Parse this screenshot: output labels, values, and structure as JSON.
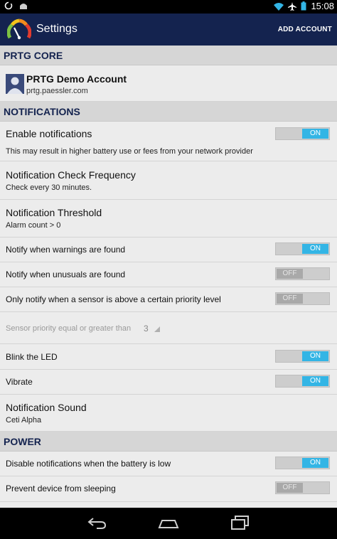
{
  "status_bar": {
    "time": "15:08",
    "icons": [
      "circle-notification-icon",
      "android-icon",
      "wifi-icon",
      "airplane-mode-icon",
      "battery-icon"
    ]
  },
  "action_bar": {
    "title": "Settings",
    "add_account": "ADD ACCOUNT",
    "logo": "prtg-gauge-logo"
  },
  "sections": {
    "core": {
      "header": "PRTG CORE"
    },
    "notifications": {
      "header": "NOTIFICATIONS"
    },
    "power": {
      "header": "POWER"
    }
  },
  "account": {
    "name": "PRTG Demo Account",
    "host": "prtg.paessler.com",
    "icon": "person-icon"
  },
  "notifications": {
    "enable": {
      "title": "Enable notifications",
      "summary": "This may result in higher battery use or fees from your network provider",
      "toggle": "ON"
    },
    "check_frequency": {
      "title": "Notification Check Frequency",
      "summary": "Check every 30 minutes."
    },
    "threshold": {
      "title": "Notification Threshold",
      "summary": "Alarm count > 0"
    },
    "warnings": {
      "title": "Notify when warnings are found",
      "toggle": "ON"
    },
    "unusuals": {
      "title": "Notify when unusuals are found",
      "toggle": "OFF"
    },
    "priority_only": {
      "title": "Only notify when a sensor is above a certain priority level",
      "toggle": "OFF"
    },
    "priority_level": {
      "title": "Sensor priority equal or greater than",
      "value": "3"
    },
    "blink_led": {
      "title": "Blink the LED",
      "toggle": "ON"
    },
    "vibrate": {
      "title": "Vibrate",
      "toggle": "ON"
    },
    "sound": {
      "title": "Notification Sound",
      "summary": "Ceti Alpha"
    }
  },
  "power": {
    "battery_low": {
      "title": "Disable notifications when the battery is low",
      "toggle": "ON"
    },
    "prevent_sleep": {
      "title": "Prevent device from sleeping",
      "toggle": "OFF"
    }
  },
  "nav_bar": {
    "icons": [
      "back-icon",
      "home-icon",
      "recent-apps-icon"
    ]
  },
  "colors": {
    "action_bar": "#14234f",
    "accent": "#33b5e5",
    "section_header": "#d6d6d6",
    "background": "#ececec"
  }
}
